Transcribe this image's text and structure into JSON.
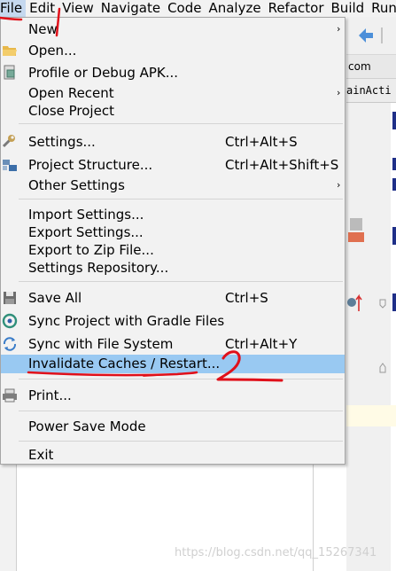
{
  "menubar": [
    "File",
    "Edit",
    "View",
    "Navigate",
    "Code",
    "Analyze",
    "Refactor",
    "Build",
    "Run"
  ],
  "background": {
    "tab1": "com",
    "tab2": "ainActi",
    "watermark": "https://blog.csdn.net/qq_15267341"
  },
  "file_menu": {
    "items": [
      {
        "label": "New",
        "arrow": "›"
      },
      {
        "label": "Open...",
        "icon": "folder-icon"
      },
      {
        "label": "Profile or Debug APK...",
        "icon": "apk-icon"
      },
      {
        "label": "Open Recent",
        "arrow": "›"
      },
      {
        "label": "Close Project"
      },
      {
        "label": "Settings...",
        "shortcut": "Ctrl+Alt+S",
        "icon": "wrench-icon"
      },
      {
        "label": "Project Structure...",
        "shortcut": "Ctrl+Alt+Shift+S",
        "icon": "project-structure-icon"
      },
      {
        "label": "Other Settings",
        "arrow": "›"
      },
      {
        "label": "Import Settings..."
      },
      {
        "label": "Export Settings..."
      },
      {
        "label": "Export to Zip File..."
      },
      {
        "label": "Settings Repository..."
      },
      {
        "label": "Save All",
        "shortcut": "Ctrl+S",
        "icon": "save-icon"
      },
      {
        "label": "Sync Project with Gradle Files",
        "icon": "gradle-sync-icon"
      },
      {
        "label": "Sync with File System",
        "shortcut": "Ctrl+Alt+Y",
        "icon": "refresh-icon"
      },
      {
        "label": "Invalidate Caches / Restart...",
        "selected": true
      },
      {
        "label": "Print...",
        "icon": "printer-icon"
      },
      {
        "label": "Power Save Mode"
      },
      {
        "label": "Exit"
      }
    ]
  },
  "annotations": {
    "step1": "1",
    "step2": "2",
    "color": "#e0101a"
  }
}
